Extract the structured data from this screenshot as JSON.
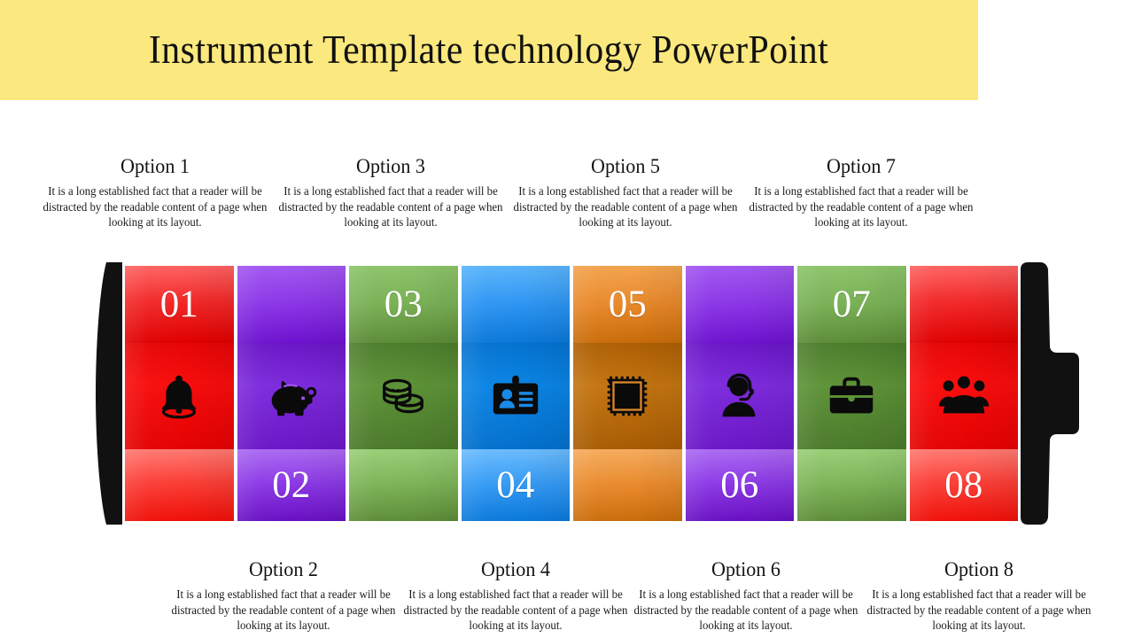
{
  "slide": {
    "title": "Instrument Template technology PowerPoint",
    "banner_color": "#fbe87e",
    "background_color": "#ffffff"
  },
  "body_text": "It is a long established fact that a reader will be distracted by the readable content of a page when looking at its layout.",
  "options": [
    {
      "heading": "Option 1",
      "body": "It is a long established fact that a reader will be distracted by the readable content of a page when looking at its layout.",
      "number": "01",
      "color_name": "red",
      "color": "#e60606",
      "icon": "bell-icon",
      "number_position": "top",
      "text_position": "top"
    },
    {
      "heading": "Option 2",
      "body": "It is a long established fact that a reader will be distracted by the readable content of a page when looking at its layout.",
      "number": "02",
      "color_name": "purple",
      "color": "#7d2bdc",
      "icon": "piggy-bank-icon",
      "number_position": "bottom",
      "text_position": "bottom"
    },
    {
      "heading": "Option 3",
      "body": "It is a long established fact that a reader will be distracted by the readable content of a page when looking at its layout.",
      "number": "03",
      "color_name": "green",
      "color": "#5d9237",
      "icon": "coins-icon",
      "number_position": "top",
      "text_position": "top"
    },
    {
      "heading": "Option 4",
      "body": "It is a long established fact that a reader will be distracted by the readable content of a page when looking at its layout.",
      "number": "04",
      "color_name": "blue",
      "color": "#0b84e4",
      "icon": "id-card-icon",
      "number_position": "bottom",
      "text_position": "bottom"
    },
    {
      "heading": "Option 5",
      "body": "It is a long established fact that a reader will be distracted by the readable content of a page when looking at its layout.",
      "number": "05",
      "color_name": "orange",
      "color": "#c37410",
      "icon": "postage-stamp-icon",
      "number_position": "top",
      "text_position": "top"
    },
    {
      "heading": "Option 6",
      "body": "It is a long established fact that a reader will be distracted by the readable content of a page when looking at its layout.",
      "number": "06",
      "color_name": "purple",
      "color": "#7d2bdc",
      "icon": "support-agent-icon",
      "number_position": "bottom",
      "text_position": "bottom"
    },
    {
      "heading": "Option 7",
      "body": "It is a long established fact that a reader will be distracted by the readable content of a page when looking at its layout.",
      "number": "07",
      "color_name": "green",
      "color": "#5d9237",
      "icon": "briefcase-icon",
      "number_position": "top",
      "text_position": "top"
    },
    {
      "heading": "Option 8",
      "body": "It is a long established fact that a reader will be distracted by the readable content of a page when looking at its layout.",
      "number": "08",
      "color_name": "red",
      "color": "#f80d0d",
      "icon": "group-people-icon",
      "number_position": "bottom",
      "text_position": "bottom"
    }
  ],
  "graphic": {
    "shape": "battery",
    "cap_color": "#111111",
    "left_cap": "battery-negative-cap",
    "right_cap": "battery-positive-terminal"
  }
}
